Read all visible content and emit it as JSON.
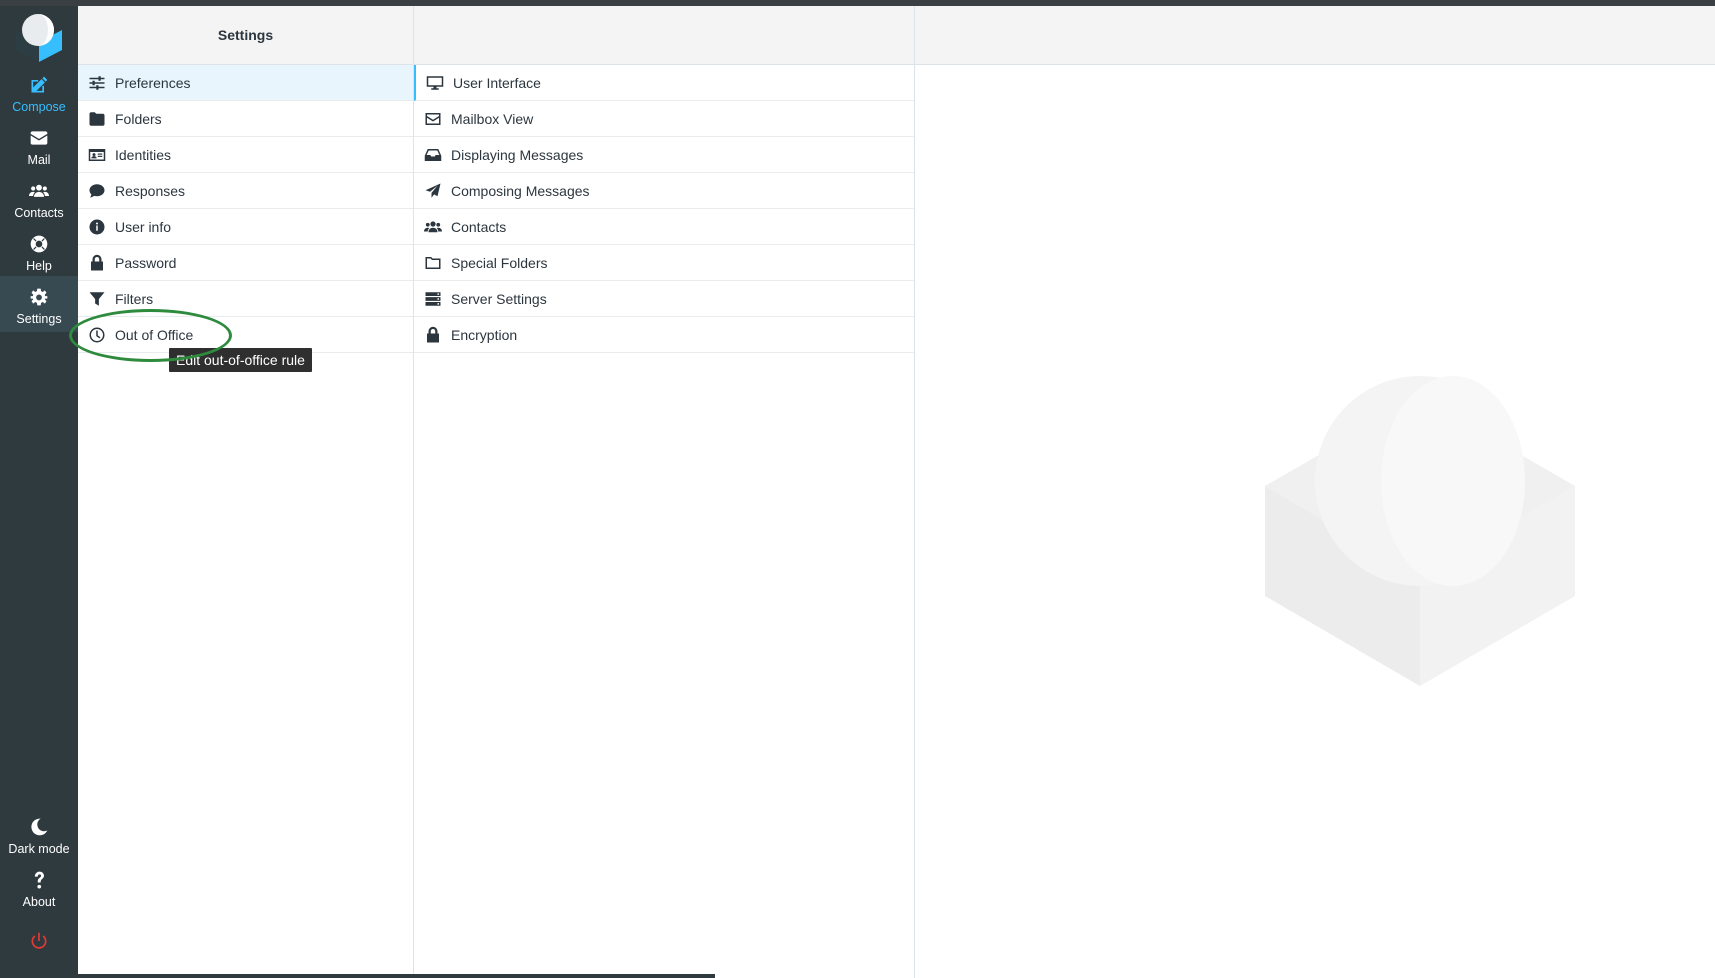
{
  "nav": {
    "compose": "Compose",
    "mail": "Mail",
    "contacts": "Contacts",
    "help": "Help",
    "settings": "Settings",
    "dark_mode": "Dark mode",
    "about": "About"
  },
  "settings_panel": {
    "title": "Settings",
    "items": [
      {
        "label": "Preferences",
        "icon": "sliders-icon"
      },
      {
        "label": "Folders",
        "icon": "folder-icon"
      },
      {
        "label": "Identities",
        "icon": "id-card-icon"
      },
      {
        "label": "Responses",
        "icon": "comment-icon"
      },
      {
        "label": "User info",
        "icon": "info-icon"
      },
      {
        "label": "Password",
        "icon": "lock-icon"
      },
      {
        "label": "Filters",
        "icon": "filter-icon"
      },
      {
        "label": "Out of Office",
        "icon": "clock-icon"
      }
    ]
  },
  "preferences_panel": {
    "items": [
      {
        "label": "User Interface",
        "icon": "monitor-icon"
      },
      {
        "label": "Mailbox View",
        "icon": "envelope-icon"
      },
      {
        "label": "Displaying Messages",
        "icon": "inbox-icon"
      },
      {
        "label": "Composing Messages",
        "icon": "paper-plane-icon"
      },
      {
        "label": "Contacts",
        "icon": "users-icon"
      },
      {
        "label": "Special Folders",
        "icon": "folder-outline-icon"
      },
      {
        "label": "Server Settings",
        "icon": "server-icon"
      },
      {
        "label": "Encryption",
        "icon": "lock-icon"
      }
    ]
  },
  "tooltip": "Edit out-of-office rule",
  "colors": {
    "accent": "#37beff",
    "rail": "#2f3a3f",
    "highlight_ring": "#2e8b3e",
    "logout": "#e53935"
  }
}
